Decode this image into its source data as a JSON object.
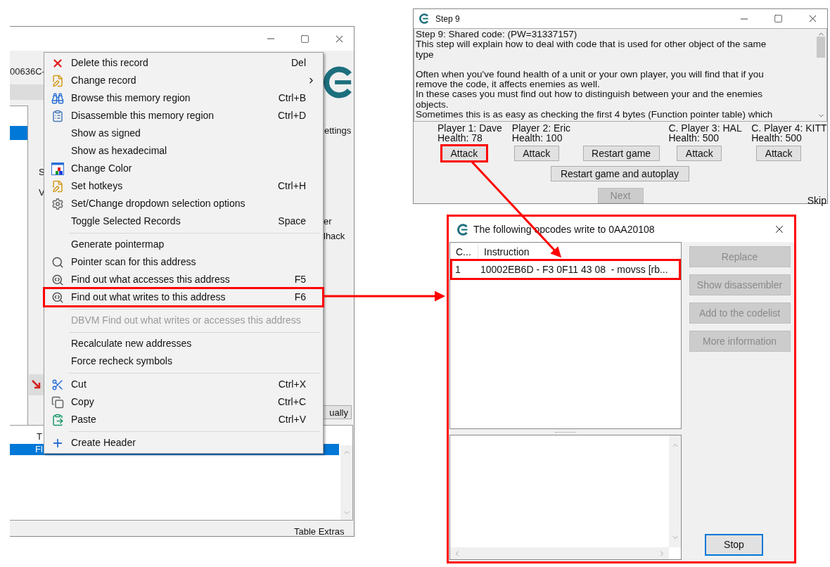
{
  "main_window": {
    "address_fragment": "00636C-",
    "settings_fragment": "ettings",
    "label_fragments": [
      "S",
      "V"
    ],
    "right_fragments": [
      "er",
      "lhack"
    ],
    "button_fragment": "ually",
    "list_header_fragment": "T",
    "list_row_fragment": "Fl",
    "status": "Table Extras"
  },
  "context_menu": {
    "items": [
      {
        "kind": "item",
        "label": "Delete this record",
        "shortcut": "Del",
        "disabled": false,
        "submenu": false,
        "highlighted": false
      },
      {
        "kind": "item",
        "label": "Change record",
        "disabled": false,
        "submenu": true,
        "highlighted": false
      },
      {
        "kind": "item",
        "label": "Browse this memory region",
        "shortcut": "Ctrl+B",
        "disabled": false,
        "submenu": false,
        "highlighted": false
      },
      {
        "kind": "item",
        "label": "Disassemble this memory region",
        "shortcut": "Ctrl+D",
        "disabled": false,
        "submenu": false,
        "highlighted": false
      },
      {
        "kind": "item",
        "label": "Show as signed",
        "disabled": false,
        "submenu": false,
        "highlighted": false
      },
      {
        "kind": "item",
        "label": "Show as hexadecimal",
        "disabled": false,
        "submenu": false,
        "highlighted": false
      },
      {
        "kind": "item",
        "label": "Change Color",
        "disabled": false,
        "submenu": false,
        "highlighted": false
      },
      {
        "kind": "item",
        "label": "Set hotkeys",
        "shortcut": "Ctrl+H",
        "disabled": false,
        "submenu": false,
        "highlighted": false
      },
      {
        "kind": "item",
        "label": "Set/Change dropdown selection options",
        "disabled": false,
        "submenu": false,
        "highlighted": false
      },
      {
        "kind": "item",
        "label": "Toggle Selected Records",
        "shortcut": "Space",
        "disabled": false,
        "submenu": false,
        "highlighted": false
      },
      {
        "kind": "separator"
      },
      {
        "kind": "item",
        "label": "Generate pointermap",
        "disabled": false,
        "submenu": false,
        "highlighted": false
      },
      {
        "kind": "item",
        "label": "Pointer scan for this address",
        "disabled": false,
        "submenu": false,
        "highlighted": false
      },
      {
        "kind": "item",
        "label": "Find out what accesses this address",
        "shortcut": "F5",
        "disabled": false,
        "submenu": false,
        "highlighted": false
      },
      {
        "kind": "item",
        "label": "Find out what writes to this address",
        "shortcut": "F6",
        "disabled": false,
        "submenu": false,
        "highlighted": true
      },
      {
        "kind": "separator"
      },
      {
        "kind": "item",
        "label": "DBVM Find out what writes or accesses this address",
        "disabled": true,
        "submenu": false,
        "highlighted": false
      },
      {
        "kind": "separator"
      },
      {
        "kind": "item",
        "label": "Recalculate new addresses",
        "disabled": false,
        "submenu": false,
        "highlighted": false
      },
      {
        "kind": "item",
        "label": "Force recheck symbols",
        "disabled": false,
        "submenu": false,
        "highlighted": false
      },
      {
        "kind": "separator"
      },
      {
        "kind": "item",
        "label": "Cut",
        "shortcut": "Ctrl+X",
        "disabled": false,
        "submenu": false,
        "highlighted": false
      },
      {
        "kind": "item",
        "label": "Copy",
        "shortcut": "Ctrl+C",
        "disabled": false,
        "submenu": false,
        "highlighted": false
      },
      {
        "kind": "item",
        "label": "Paste",
        "shortcut": "Ctrl+V",
        "disabled": false,
        "submenu": false,
        "highlighted": false
      },
      {
        "kind": "separator"
      },
      {
        "kind": "item",
        "label": "Create Header",
        "disabled": false,
        "submenu": false,
        "highlighted": false
      }
    ]
  },
  "step_window": {
    "title": "Step 9",
    "paragraphs": [
      [
        "Step 9: Shared code: (PW=31337157)",
        "This step will explain how to deal with code that is used for other object of the same",
        "type"
      ],
      [
        "Often when you've found health of a unit or your own player, you will find that if you",
        "remove the code, it affects enemies as well.",
        "In these cases you must find out how to distinguish between your and the enemies",
        "objects.",
        "Sometimes this is as easy as checking the first 4 bytes (Function pointer table) which"
      ]
    ],
    "players": [
      {
        "name": "Player 1: Dave",
        "health": "Health: 78",
        "attack": "Attack",
        "highlighted": true
      },
      {
        "name": "Player 2: Eric",
        "health": "Health: 100",
        "attack": "Attack",
        "highlighted": false
      },
      {
        "name": "C. Player 3: HAL",
        "health": "Health: 500",
        "attack": "Attack",
        "highlighted": false
      },
      {
        "name": "C. Player 4: KITT",
        "health": "Health: 500",
        "attack": "Attack",
        "highlighted": false
      }
    ],
    "restart": "Restart game",
    "autoplay": "Restart game and autoplay",
    "next": {
      "label": "Next",
      "disabled": true
    },
    "skip": "Skip"
  },
  "opcodes_window": {
    "title": "The following opcodes write to 0AA20108",
    "annotated": true,
    "columns": [
      "C...",
      "Instruction"
    ],
    "rows": [
      {
        "cells": [
          "1",
          "10002EB6D - F3 0F11 43 08  - movss [rb..."
        ],
        "highlighted": true
      }
    ],
    "buttons": [
      {
        "label": "Replace",
        "disabled": true
      },
      {
        "label": "Show disassembler",
        "disabled": true
      },
      {
        "label": "Add to the codelist",
        "disabled": true
      },
      {
        "label": "More information",
        "disabled": true
      }
    ],
    "stop": "Stop"
  }
}
